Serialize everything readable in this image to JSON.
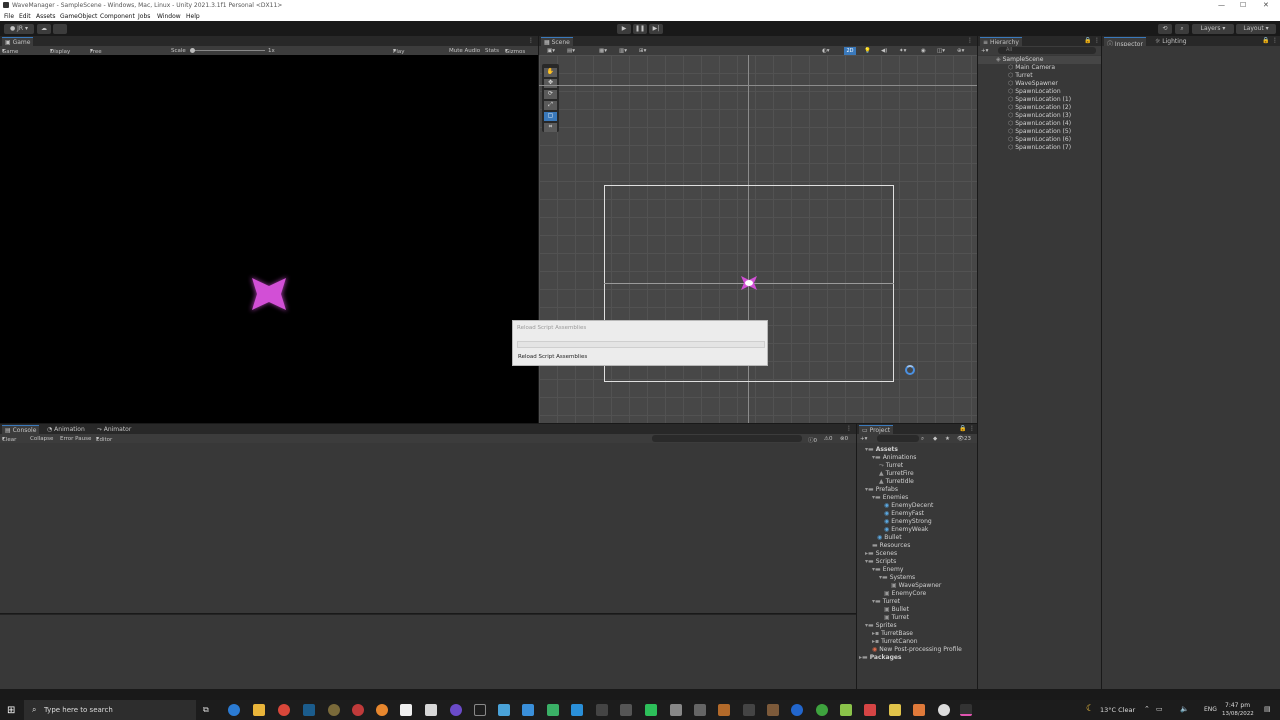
{
  "window": {
    "title": "WaveManager - SampleScene - Windows, Mac, Linux - Unity 2021.3.1f1 Personal <DX11>"
  },
  "menu": [
    "File",
    "Edit",
    "Assets",
    "GameObject",
    "Component",
    "Jobs",
    "Window",
    "Help"
  ],
  "toolbar": {
    "account": "JR",
    "layers": "Layers",
    "layout": "Layout"
  },
  "game_view": {
    "tab": "Game",
    "display_mode": "Game",
    "display": "Display 1",
    "aspect": "Free Aspect",
    "scale_label": "Scale",
    "scale_value": "1x",
    "play_focused": "Play Focused",
    "mute_audio": "Mute Audio",
    "stats": "Stats",
    "gizmos": "Gizmos"
  },
  "scene_view": {
    "tab": "Scene",
    "mode_2d": "2D"
  },
  "hierarchy": {
    "tab": "Hierarchy",
    "search_placeholder": "All",
    "scene": "SampleScene",
    "items": [
      "Main Camera",
      "Turret",
      "WaveSpawner",
      "SpawnLocation",
      "SpawnLocation (1)",
      "SpawnLocation (2)",
      "SpawnLocation (3)",
      "SpawnLocation (4)",
      "SpawnLocation (5)",
      "SpawnLocation (6)",
      "SpawnLocation (7)"
    ]
  },
  "inspector": {
    "tab": "Inspector",
    "lighting_tab": "Lighting"
  },
  "bottom_tabs": {
    "console": "Console",
    "animation": "Animation",
    "animator": "Animator"
  },
  "console": {
    "clear": "Clear",
    "collapse": "Collapse",
    "error_pause": "Error Pause",
    "editor": "Editor",
    "log_count": "0",
    "warn_count": "0",
    "error_count": "0"
  },
  "project": {
    "tab": "Project",
    "count": "23",
    "tree": [
      {
        "label": "Assets",
        "depth": 0
      },
      {
        "label": "Animations",
        "depth": 1
      },
      {
        "label": "Turret",
        "depth": 2
      },
      {
        "label": "TurretFire",
        "depth": 2
      },
      {
        "label": "TurretIdle",
        "depth": 2
      },
      {
        "label": "Prefabs",
        "depth": 1
      },
      {
        "label": "Enemies",
        "depth": 2
      },
      {
        "label": "EnemyDecent",
        "depth": 3
      },
      {
        "label": "EnemyFast",
        "depth": 3
      },
      {
        "label": "EnemyStrong",
        "depth": 3
      },
      {
        "label": "EnemyWeak",
        "depth": 3
      },
      {
        "label": "Bullet",
        "depth": 2
      },
      {
        "label": "Resources",
        "depth": 1
      },
      {
        "label": "Scenes",
        "depth": 1
      },
      {
        "label": "Scripts",
        "depth": 1
      },
      {
        "label": "Enemy",
        "depth": 2
      },
      {
        "label": "Systems",
        "depth": 3
      },
      {
        "label": "WaveSpawner",
        "depth": 4
      },
      {
        "label": "EnemyCore",
        "depth": 3
      },
      {
        "label": "Turret",
        "depth": 2
      },
      {
        "label": "Bullet",
        "depth": 3
      },
      {
        "label": "Turret",
        "depth": 3
      },
      {
        "label": "Sprites",
        "depth": 1
      },
      {
        "label": "TurretBase",
        "depth": 2
      },
      {
        "label": "TurretCanon",
        "depth": 2
      },
      {
        "label": "New Post-processing Profile",
        "depth": 1
      },
      {
        "label": "Packages",
        "depth": 0
      }
    ]
  },
  "dialog": {
    "title": "Reload Script Assemblies",
    "message": "Reload Script Assemblies"
  },
  "taskbar": {
    "search_placeholder": "Type here to search",
    "weather": "13°C  Clear",
    "lang": "ENG",
    "time": "7:47 pm",
    "date": "13/08/2022"
  },
  "colors": {
    "accent": "#3a79bb",
    "enemy_magenta": "#d24fd6",
    "panel": "#383838",
    "background": "#191919"
  }
}
